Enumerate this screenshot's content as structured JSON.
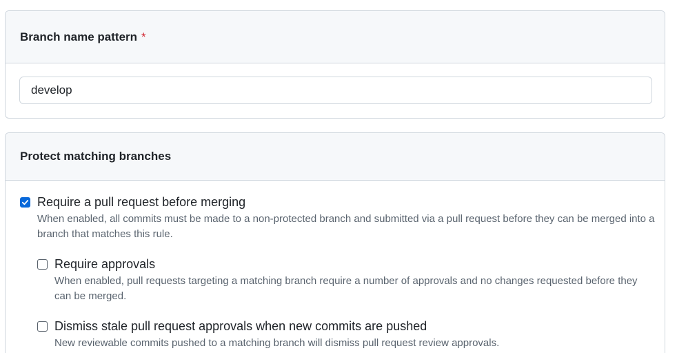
{
  "branch_pattern": {
    "label": "Branch name pattern",
    "required_marker": "*",
    "value": "develop"
  },
  "protect": {
    "heading": "Protect matching branches",
    "options": [
      {
        "label": "Require a pull request before merging",
        "checked": true,
        "description": "When enabled, all commits must be made to a non-protected branch and submitted via a pull request before they can be merged into a branch that matches this rule."
      },
      {
        "label": "Require approvals",
        "checked": false,
        "description": "When enabled, pull requests targeting a matching branch require a number of approvals and no changes requested before they can be merged."
      },
      {
        "label": "Dismiss stale pull request approvals when new commits are pushed",
        "checked": false,
        "description": "New reviewable commits pushed to a matching branch will dismiss pull request review approvals."
      }
    ]
  },
  "colors": {
    "accent": "#0969da",
    "required": "#d1242f",
    "border": "#d0d7de",
    "header_bg": "#f6f8fa",
    "muted_text": "#59636e"
  },
  "icons": {
    "checkmark": "check-icon"
  }
}
